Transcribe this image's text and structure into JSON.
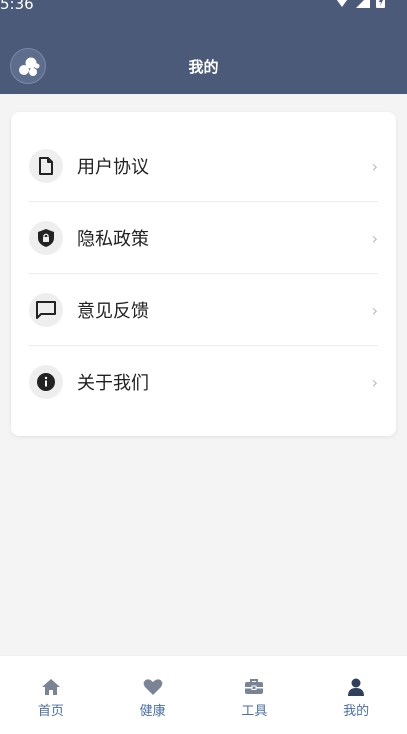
{
  "status_bar": {
    "time": "5:36"
  },
  "header": {
    "title": "我的"
  },
  "menu": {
    "items": [
      {
        "label": "用户协议",
        "icon": "document-icon"
      },
      {
        "label": "隐私政策",
        "icon": "shield-lock-icon"
      },
      {
        "label": "意见反馈",
        "icon": "chat-icon"
      },
      {
        "label": "关于我们",
        "icon": "info-icon"
      }
    ],
    "chevron": "›"
  },
  "tabbar": {
    "tabs": [
      {
        "label": "首页",
        "icon": "home-icon",
        "active": false
      },
      {
        "label": "健康",
        "icon": "heart-icon",
        "active": false
      },
      {
        "label": "工具",
        "icon": "toolbox-icon",
        "active": false
      },
      {
        "label": "我的",
        "icon": "user-icon",
        "active": true
      }
    ]
  },
  "colors": {
    "header_bg": "#4a5a78",
    "tab_inactive_icon": "#7a8496",
    "tab_active_icon": "#2f3f5c",
    "tab_label": "#4a6fa5"
  }
}
